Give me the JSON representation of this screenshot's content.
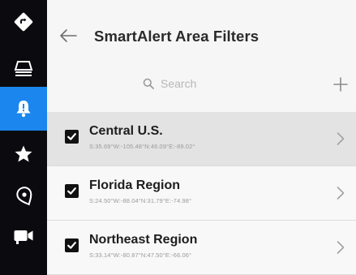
{
  "header": {
    "title": "SmartAlert Area Filters"
  },
  "search": {
    "placeholder": "Search"
  },
  "rail": {
    "items": [
      {
        "icon": "direction-sign-icon",
        "active": false
      },
      {
        "icon": "layers-icon",
        "active": false
      },
      {
        "icon": "bell-icon",
        "active": true
      },
      {
        "icon": "star-icon",
        "active": false
      },
      {
        "icon": "location-pin-icon",
        "active": false
      },
      {
        "icon": "video-camera-icon",
        "active": false
      }
    ]
  },
  "areas": [
    {
      "name": "Central U.S.",
      "bounds": "S:35.69°W:-105.48°N:46.09°E:-89.02°",
      "checked": true,
      "selected": true
    },
    {
      "name": "Florida Region",
      "bounds": "S:24.50°W:-88.04°N:31.79°E:-74.98°",
      "checked": true,
      "selected": false
    },
    {
      "name": "Northeast Region",
      "bounds": "S:33.14°W:-80.87°N:47.50°E:-66.06°",
      "checked": true,
      "selected": false
    }
  ],
  "colors": {
    "rail_bg": "#0b0b0f",
    "accent": "#1a86ee",
    "selected_row": "#e3e3e3"
  }
}
